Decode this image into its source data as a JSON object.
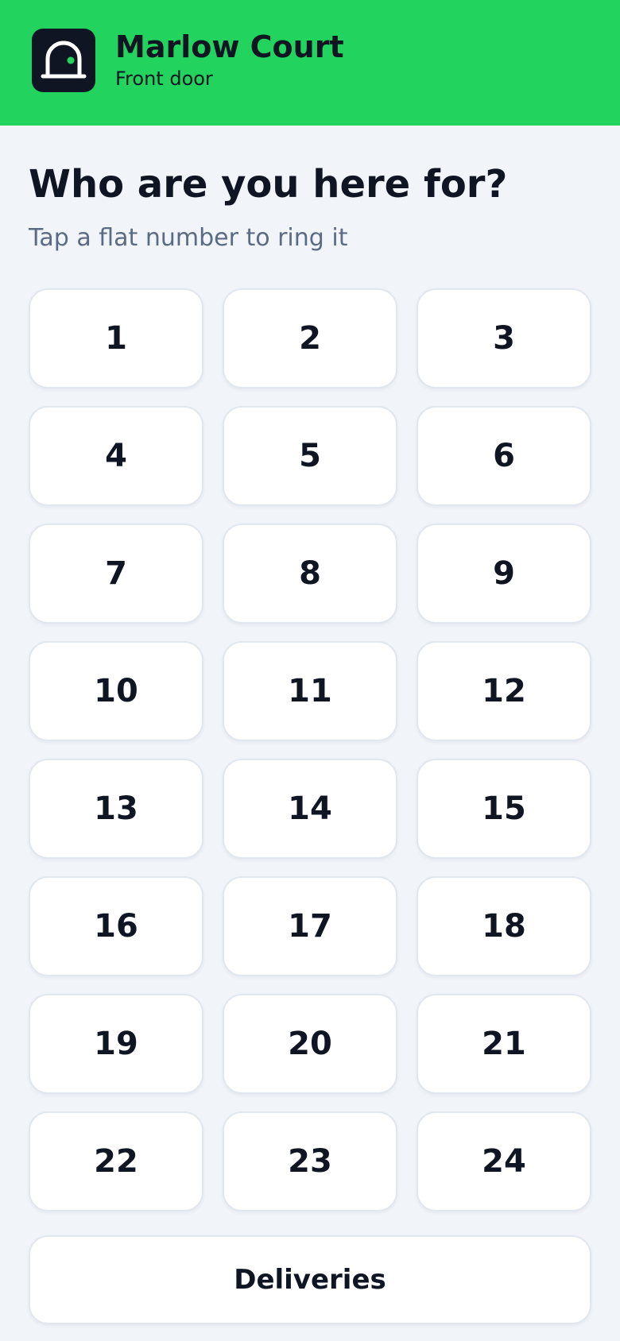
{
  "header": {
    "title": "Marlow Court",
    "subtitle": "Front door",
    "icon": "door-icon",
    "background_color": "#22d45d"
  },
  "main": {
    "title": "Who are you here for?",
    "subtitle": "Tap a flat number to ring it"
  },
  "flats": [
    "1",
    "2",
    "3",
    "4",
    "5",
    "6",
    "7",
    "8",
    "9",
    "10",
    "11",
    "12",
    "13",
    "14",
    "15",
    "16",
    "17",
    "18",
    "19",
    "20",
    "21",
    "22",
    "23",
    "24"
  ],
  "deliveries": {
    "label": "Deliveries"
  },
  "colors": {
    "accent": "#22d45d",
    "text": "#0f1522",
    "muted": "#5b6b82",
    "background": "#f1f5fa"
  }
}
